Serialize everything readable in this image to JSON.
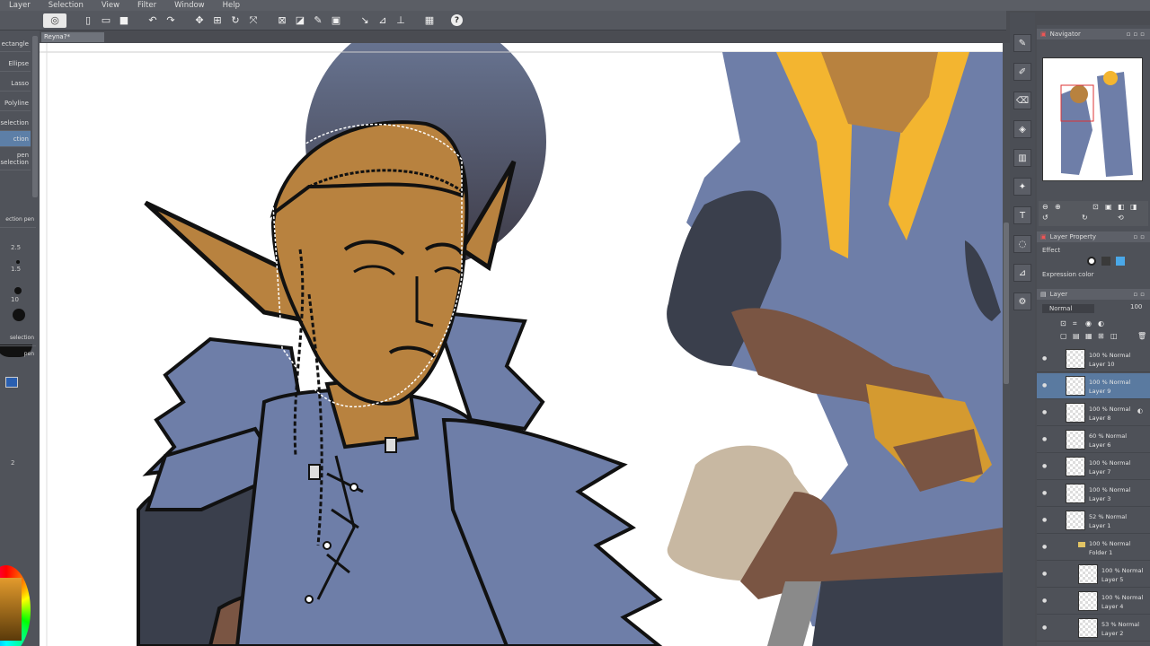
{
  "menubar": {
    "items": [
      "Layer",
      "Selection",
      "View",
      "Filter",
      "Window",
      "Help"
    ]
  },
  "toolbar": {
    "help_label": "?"
  },
  "document": {
    "tab_name": "Reyna?*"
  },
  "left_panel": {
    "tools": [
      "ectangle",
      "Ellipse",
      "Lasso",
      "Polyline",
      "selection",
      "ction pen",
      "selection"
    ],
    "brush_label": "ection pen",
    "brush_label_2": "selection pen",
    "size_values": [
      "2.5",
      "1.5",
      "10",
      "2"
    ]
  },
  "navigator": {
    "title": "Navigator"
  },
  "layer_property": {
    "title": "Layer Property",
    "effect_label": "Effect",
    "expression_label": "Expression color",
    "swatch_colors": [
      "#ffffff",
      "#3a3a3a",
      "#4aa8e8"
    ]
  },
  "layers_panel": {
    "title": "Layer",
    "blend_mode": "Normal",
    "opacity": "100",
    "layers": [
      {
        "mode": "100 % Normal",
        "name": "Layer 10",
        "selected": false
      },
      {
        "mode": "100 % Normal",
        "name": "Layer 9",
        "selected": true
      },
      {
        "mode": "100 % Normal",
        "name": "Layer 8",
        "selected": false
      },
      {
        "mode": "60 % Normal",
        "name": "Layer 6",
        "selected": false
      },
      {
        "mode": "100 % Normal",
        "name": "Layer 7",
        "selected": false
      },
      {
        "mode": "100 % Normal",
        "name": "Layer 3",
        "selected": false
      },
      {
        "mode": "52 % Normal",
        "name": "Layer 1",
        "selected": false
      },
      {
        "mode": "100 % Normal",
        "name": "Folder 1",
        "selected": false,
        "folder": true
      },
      {
        "mode": "100 % Normal",
        "name": "Layer 5",
        "selected": false,
        "indent": true
      },
      {
        "mode": "100 % Normal",
        "name": "Layer 4",
        "selected": false,
        "indent": true
      },
      {
        "mode": "53 % Normal",
        "name": "Layer 2",
        "selected": false,
        "indent": true
      }
    ]
  },
  "colors": {
    "skin": "#b8823f",
    "cloak": "#6e7ea8",
    "hair_yellow": "#f3b530",
    "dark": "#3a3f4c",
    "brown": "#7a5543",
    "beige": "#c8b8a2"
  }
}
